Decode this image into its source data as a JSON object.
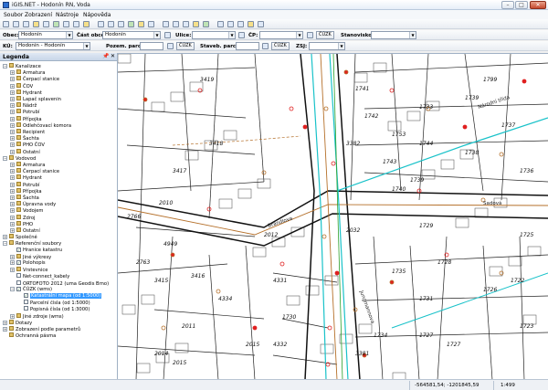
{
  "window": {
    "title": "iGIS.NET - Hodonín RN, Voda",
    "minimize": "–",
    "maximize": "□",
    "close": "✕"
  },
  "menu": [
    "Soubor",
    "Zobrazení",
    "Nástroje",
    "Nápověda"
  ],
  "toolbar2": {
    "obec_label": "Obec:",
    "obec_value": "Hodonín",
    "cast_obce_label": "Část obce:",
    "cast_obce_value": "Hodonín",
    "ulice_label": "Ulice:",
    "cp_label": "ČP:",
    "cuzk_label": "ČÚZK",
    "stanovisko_label": "Stanovisko:"
  },
  "toolbar3": {
    "ku_label": "KÚ:",
    "ku_value": "Hodonín - Hodonín",
    "pozem_label": "Pozem. parc.:",
    "cuzk_label": "ČÚZK",
    "staveb_label": "Staveb. parc.:",
    "cuzk_label2": "ČÚZK",
    "zsj_label": "ZSJ:"
  },
  "legend": {
    "title": "Legenda",
    "items": [
      {
        "label": "Kanalizace",
        "level": 0,
        "exp": "−"
      },
      {
        "label": "Armatura",
        "level": 1,
        "exp": "+"
      },
      {
        "label": "Čerpací stanice",
        "level": 1,
        "exp": "+"
      },
      {
        "label": "ČOV",
        "level": 1,
        "exp": "+"
      },
      {
        "label": "Hydrant",
        "level": 1,
        "exp": "+"
      },
      {
        "label": "Lapač splavenin",
        "level": 1,
        "exp": "+"
      },
      {
        "label": "Nádrž",
        "level": 1,
        "exp": "+"
      },
      {
        "label": "Potrubí",
        "level": 1,
        "exp": "+"
      },
      {
        "label": "Přípojka",
        "level": 1,
        "exp": "+"
      },
      {
        "label": "Odlehčovací komora",
        "level": 1,
        "exp": "+"
      },
      {
        "label": "Recipient",
        "level": 1,
        "exp": "+"
      },
      {
        "label": "Šachta",
        "level": 1,
        "exp": "+"
      },
      {
        "label": "PHO ČOV",
        "level": 1,
        "exp": "+"
      },
      {
        "label": "Ostatní",
        "level": 1,
        "exp": "+"
      },
      {
        "label": "Vodovod",
        "level": 0,
        "exp": "−"
      },
      {
        "label": "Armatura",
        "level": 1,
        "exp": "+"
      },
      {
        "label": "Čerpací stanice",
        "level": 1,
        "exp": "+"
      },
      {
        "label": "Hydrant",
        "level": 1,
        "exp": "+"
      },
      {
        "label": "Potrubí",
        "level": 1,
        "exp": "+"
      },
      {
        "label": "Přípojka",
        "level": 1,
        "exp": "+"
      },
      {
        "label": "Šachta",
        "level": 1,
        "exp": "+"
      },
      {
        "label": "Úpravna vody",
        "level": 1,
        "exp": "+"
      },
      {
        "label": "Vodojem",
        "level": 1,
        "exp": "+"
      },
      {
        "label": "Zdroj",
        "level": 1,
        "exp": "+"
      },
      {
        "label": "PHO",
        "level": 1,
        "exp": "+"
      },
      {
        "label": "Ostatní",
        "level": 1,
        "exp": "+"
      },
      {
        "label": "Společné",
        "level": 0,
        "exp": "+"
      },
      {
        "label": "Referenční soubory",
        "level": 0,
        "exp": "−"
      },
      {
        "label": "Hranice katastru",
        "level": 1,
        "chk": true
      },
      {
        "label": "Jiné výkresy",
        "level": 1,
        "exp": "+"
      },
      {
        "label": "Polohopis",
        "level": 1,
        "exp": "+",
        "chk": true
      },
      {
        "label": "Vrstevnice",
        "level": 1,
        "exp": "+"
      },
      {
        "label": "Net-connect_kabely",
        "level": 1,
        "chk": false
      },
      {
        "label": "ORTOFOTO 2012 (uma Geodis Brno)",
        "level": 1,
        "chk": false
      },
      {
        "label": "ČÚZK (wms)",
        "level": 1,
        "exp": "−",
        "chk": true
      },
      {
        "label": "Katastrální mapa (od 1:5000)",
        "level": 2,
        "chk": true,
        "sel": true
      },
      {
        "label": "Parcelní čísla (od 1:5000)",
        "level": 2,
        "chk": false
      },
      {
        "label": "Popisná čísla (od 1:3000)",
        "level": 2,
        "chk": false
      },
      {
        "label": "Jiné zdroje (wms)",
        "level": 1,
        "exp": "+"
      },
      {
        "label": "Dotazy",
        "level": 0,
        "exp": "+"
      },
      {
        "label": "Zobrazení podle parametrů",
        "level": 0,
        "exp": "+"
      },
      {
        "label": "Ochranná pásma",
        "level": 0
      }
    ]
  },
  "map_labels": [
    "3419",
    "3418",
    "3417",
    "2010",
    "4949",
    "3415",
    "3416",
    "4334",
    "2012",
    "2011",
    "2763",
    "2015",
    "2014",
    "1730",
    "1729",
    "1728",
    "1740",
    "1739",
    "1733",
    "1742",
    "1741",
    "1743",
    "1744",
    "2032",
    "2766",
    "2015",
    "1739",
    "1737",
    "1736",
    "1735",
    "1731",
    "1727",
    "1726",
    "3382",
    "4331",
    "4332",
    "1725",
    "1734",
    "1727",
    "1738",
    "1722",
    "1723",
    "3381",
    "1799",
    "1753"
  ],
  "street_labels": [
    "Brandlova",
    "Národní třída",
    "Sadová",
    "Jungmannova"
  ],
  "status": {
    "coords": "-564581,54; -1201845,59",
    "scale": "1:499"
  },
  "colors": {
    "pipe_cyan": "#19c2c9",
    "pipe_brown": "#b5702a",
    "pipe_red": "#e02020",
    "pipe_green": "#2aa02a",
    "selection": "#3399ff"
  }
}
